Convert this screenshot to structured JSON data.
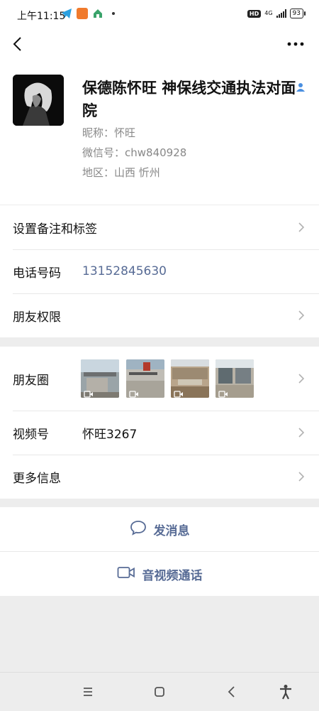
{
  "status_bar": {
    "time": "上午11:15",
    "network": "4G",
    "battery": "93"
  },
  "profile": {
    "name": "保德陈怀旺  神保线交通执法对面院",
    "nickname": "昵称：怀旺",
    "wechat_id": "微信号：chw840928",
    "region": "地区：山西  忻州"
  },
  "rows": {
    "remark": "设置备注和标签",
    "phone_label": "电话号码",
    "phone_value": "13152845630",
    "permissions": "朋友权限",
    "moments": "朋友圈",
    "channels_label": "视频号",
    "channels_value": "怀旺3267",
    "more": "更多信息"
  },
  "actions": {
    "message": "发消息",
    "call": "音视频通话"
  },
  "colors": {
    "link": "#576b95",
    "background": "#ededed"
  }
}
